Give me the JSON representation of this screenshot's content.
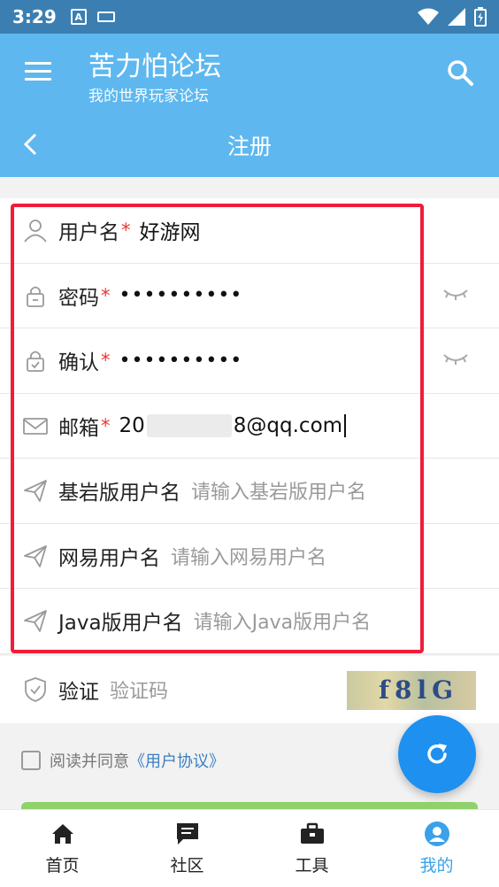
{
  "status_bar": {
    "time": "3:29",
    "notif_icon": "A"
  },
  "app_bar": {
    "title": "苦力怕论坛",
    "subtitle": "我的世界玩家论坛"
  },
  "sub_bar": {
    "title": "注册"
  },
  "form": {
    "username": {
      "label": "用户名",
      "required": "*",
      "value": "好游网"
    },
    "password": {
      "label": "密码",
      "required": "*",
      "value": "••••••••••"
    },
    "confirm": {
      "label": "确认",
      "required": "*",
      "value": "••••••••••"
    },
    "email": {
      "label": "邮箱",
      "required": "*",
      "value_prefix": "20",
      "value_suffix": "8@qq.com"
    },
    "bedrock": {
      "label": "基岩版用户名",
      "placeholder": "请输入基岩版用户名"
    },
    "netease": {
      "label": "网易用户名",
      "placeholder": "请输入网易用户名"
    },
    "java": {
      "label": "Java版用户名",
      "placeholder": "请输入Java版用户名"
    },
    "verify": {
      "label": "验证",
      "placeholder": "验证码",
      "captcha_text": "f8lG"
    }
  },
  "agreement": {
    "text": "阅读并同意",
    "link": "《用户协议》"
  },
  "bottom_nav": [
    {
      "label": "首页",
      "icon": "home-icon"
    },
    {
      "label": "社区",
      "icon": "chat-icon"
    },
    {
      "label": "工具",
      "icon": "toolbox-icon"
    },
    {
      "label": "我的",
      "icon": "profile-icon"
    }
  ],
  "colors": {
    "header": "#5eb8ef",
    "status": "#3b7fb2",
    "highlight_frame": "#ef1d3a",
    "fab": "#1e90f0",
    "active_nav": "#3aa1ea"
  }
}
